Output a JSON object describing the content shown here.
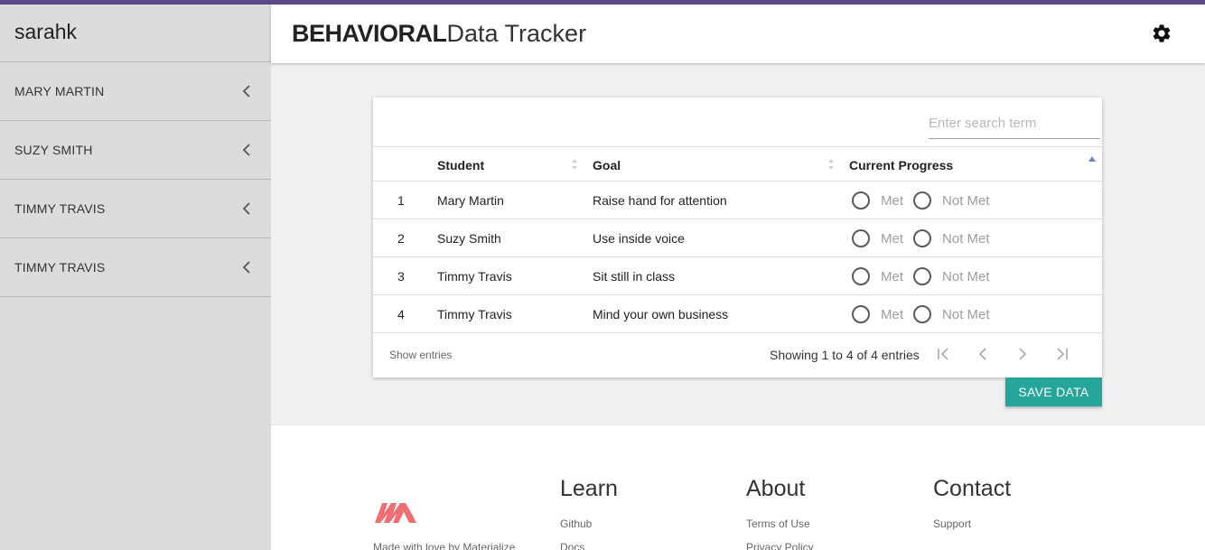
{
  "sidebar": {
    "username": "sarahk",
    "items": [
      {
        "label": "MARY MARTIN"
      },
      {
        "label": "SUZY SMITH"
      },
      {
        "label": "TIMMY TRAVIS"
      },
      {
        "label": "TIMMY TRAVIS"
      }
    ]
  },
  "header": {
    "brand_bold": "BEHAVIORAL",
    "brand_light": "Data Tracker",
    "settings_icon": "gear-icon"
  },
  "table": {
    "search_placeholder": "Enter search term",
    "columns": {
      "student": "Student",
      "goal": "Goal",
      "progress": "Current Progress"
    },
    "rows": [
      {
        "num": "1",
        "student": "Mary Martin",
        "goal": "Raise hand for attention",
        "met": "Met",
        "not_met": "Not Met"
      },
      {
        "num": "2",
        "student": "Suzy Smith",
        "goal": "Use inside voice",
        "met": "Met",
        "not_met": "Not Met"
      },
      {
        "num": "3",
        "student": "Timmy Travis",
        "goal": "Sit still in class",
        "met": "Met",
        "not_met": "Not Met"
      },
      {
        "num": "4",
        "student": "Timmy Travis",
        "goal": "Mind your own business",
        "met": "Met",
        "not_met": "Not Met"
      }
    ],
    "show_entries": "Show entries",
    "showing": "Showing 1 to 4 of 4 entries"
  },
  "actions": {
    "save_label": "SAVE DATA"
  },
  "footer": {
    "made_with": "Made with love by Materialize",
    "learn": {
      "title": "Learn",
      "links": [
        "Github",
        "Docs"
      ]
    },
    "about": {
      "title": "About",
      "links": [
        "Terms of Use",
        "Privacy Policy"
      ]
    },
    "contact": {
      "title": "Contact",
      "links": [
        "Support"
      ]
    }
  },
  "colors": {
    "accent": "#26a69a",
    "topbar": "#5b4a8b",
    "logo": "#ee6e73"
  }
}
